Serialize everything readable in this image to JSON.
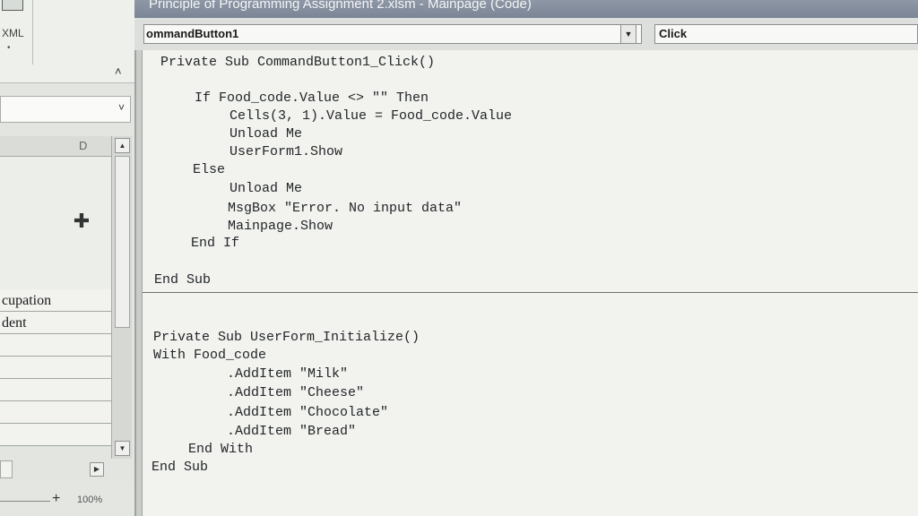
{
  "window": {
    "title": "Principle of Programming Assignment 2.xlsm - Mainpage (Code)"
  },
  "combos": {
    "object": "ommandButton1",
    "procedure": "Click"
  },
  "excel": {
    "ribbon_label": "XML",
    "ribbon_dot": "•",
    "collapse_glyph": "˄",
    "namebox_arrow": "˅",
    "column_header": "D",
    "rows": [
      "cupation",
      "dent",
      "",
      "",
      "",
      "",
      "",
      ""
    ],
    "zoom_plus": "+",
    "zoom_value": "100%",
    "scroll_up": "▲",
    "scroll_down": "▼",
    "scroll_right": "▶",
    "cursor_glyph": "✚"
  },
  "code": {
    "lines": [
      "Private Sub CommandButton1_Click()",
      "If Food_code.Value <> \"\" Then",
      "Cells(3, 1).Value = Food_code.Value",
      "Unload Me",
      "UserForm1.Show",
      "Else",
      "Unload Me",
      "MsgBox \"Error. No input data\"",
      "Mainpage.Show",
      "End If",
      "End Sub",
      "Private Sub UserForm_Initialize()",
      "With Food_code",
      ".AddItem \"Milk\"",
      ".AddItem \"Cheese\"",
      ".AddItem \"Chocolate\"",
      ".AddItem \"Bread\"",
      "End With",
      "End Sub"
    ]
  }
}
